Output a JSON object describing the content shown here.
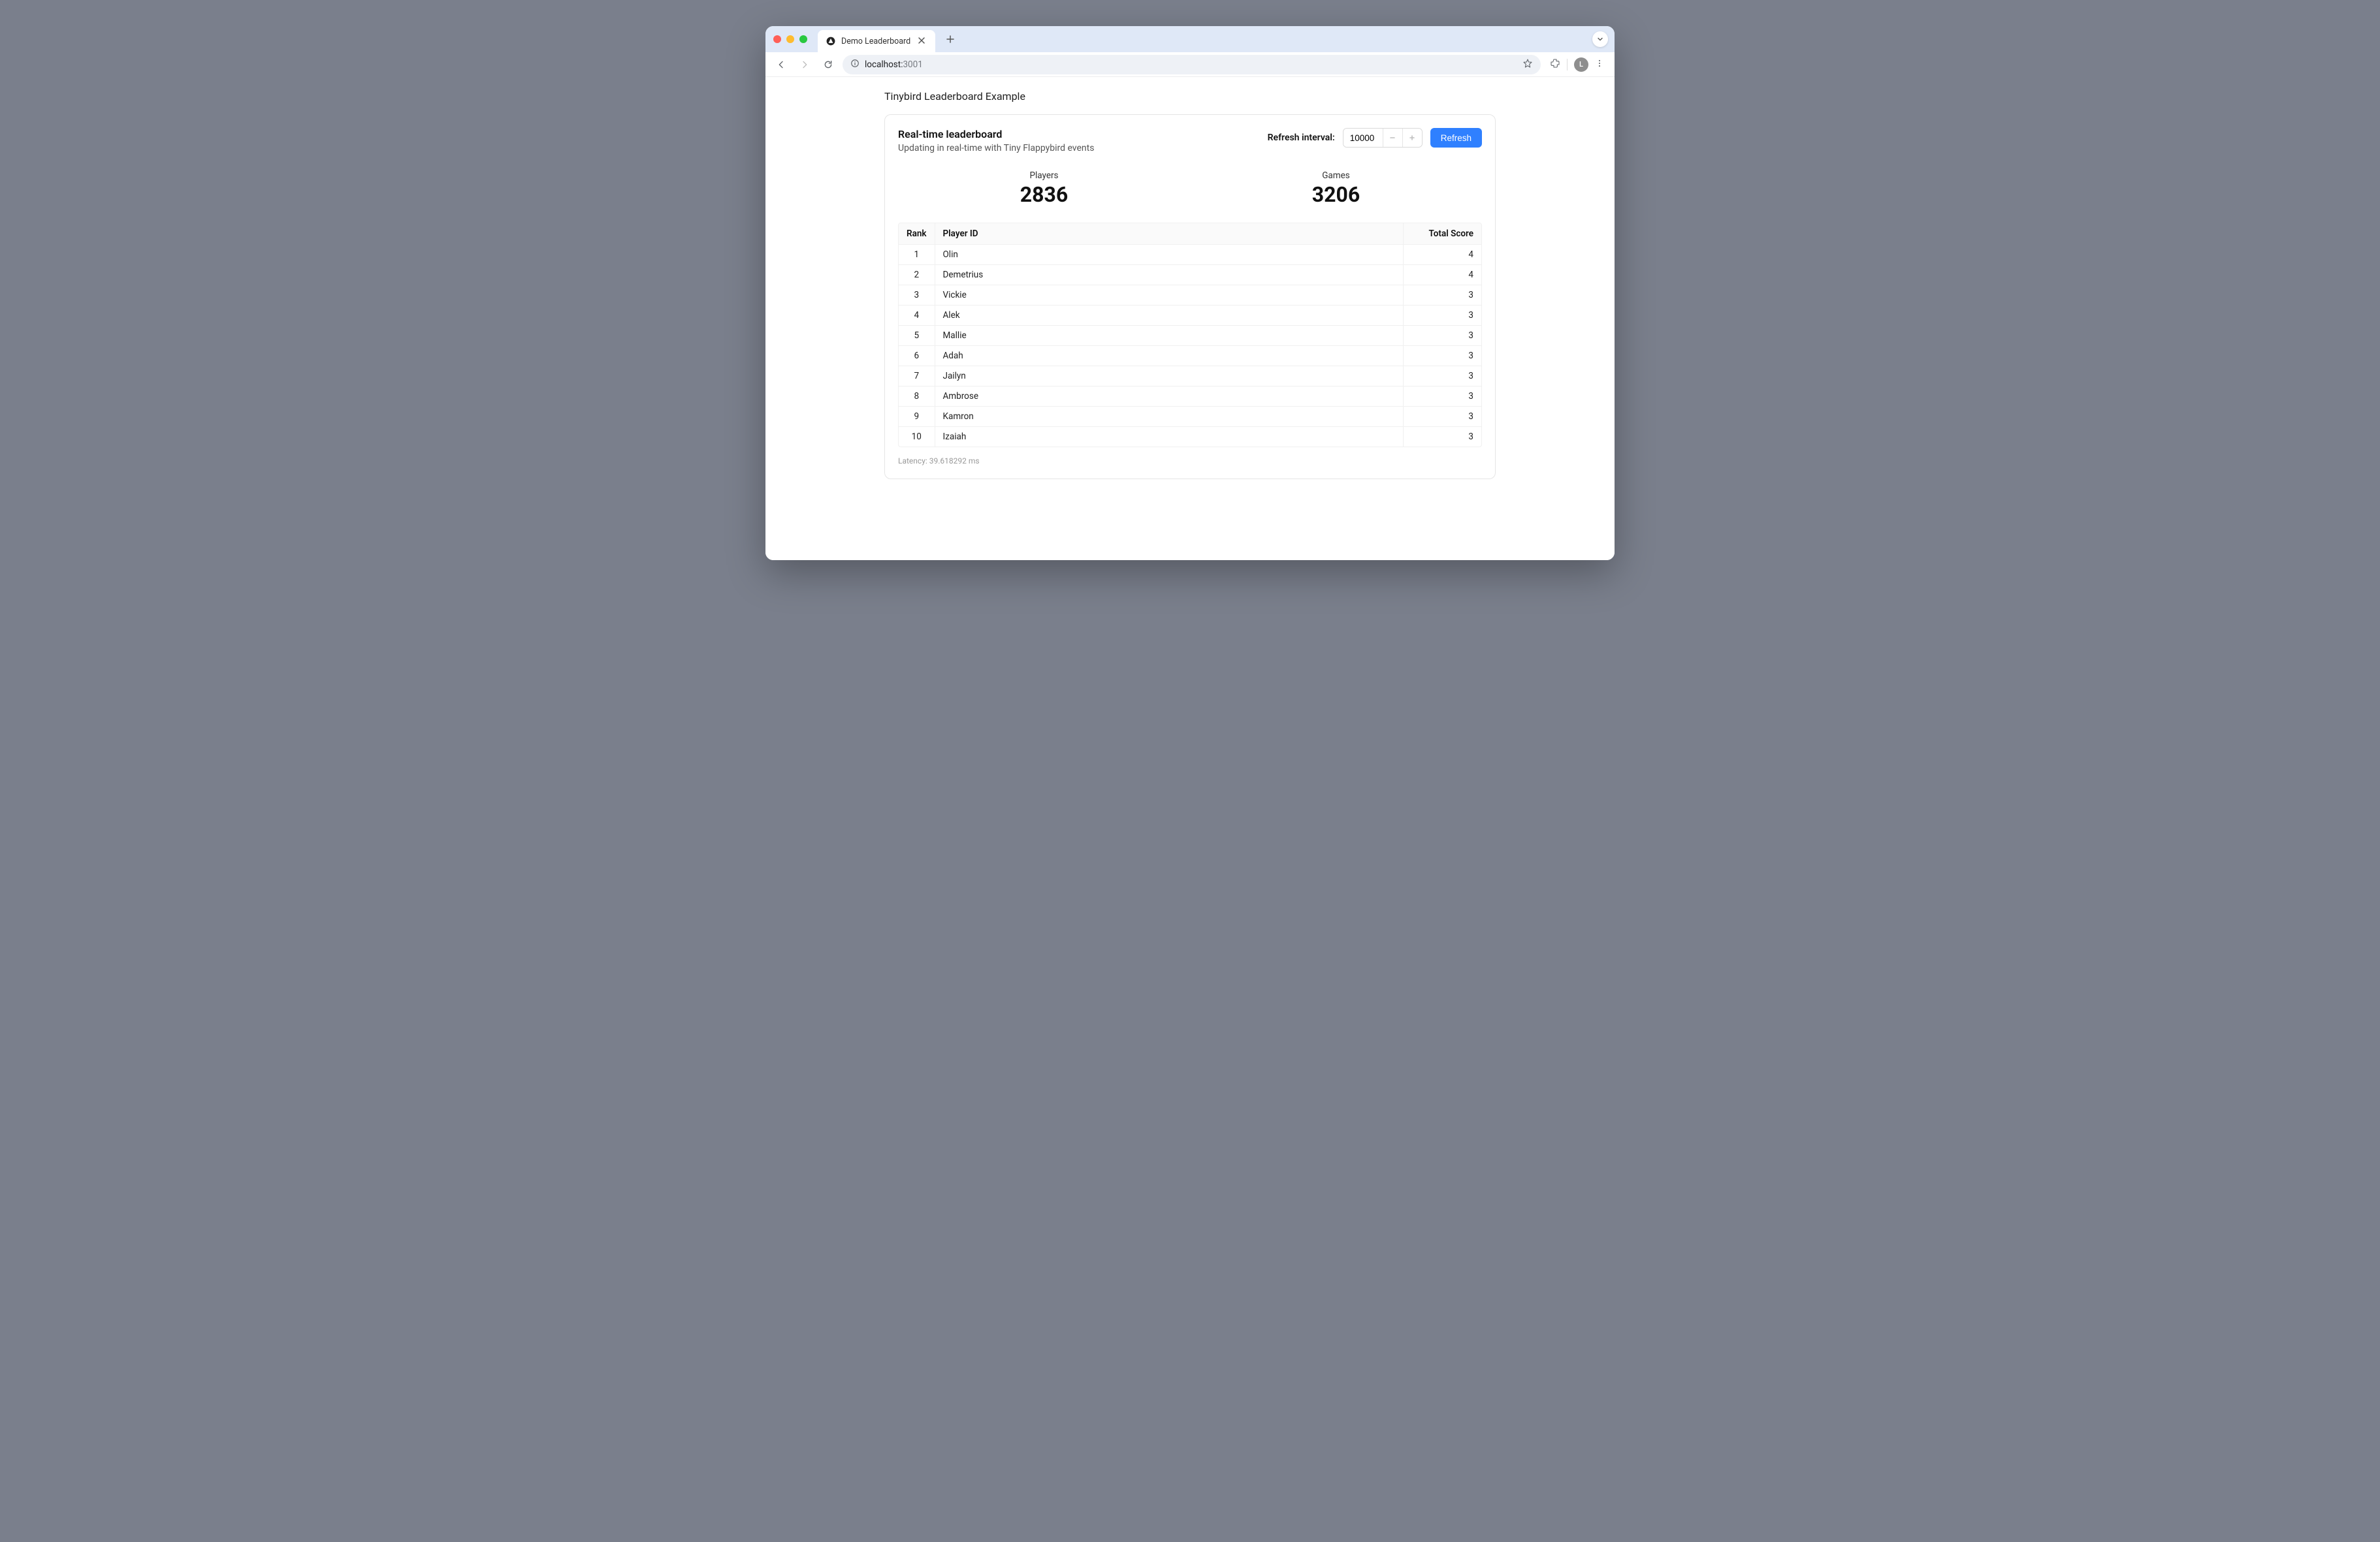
{
  "browser": {
    "tab_title": "Demo Leaderboard",
    "url_host": "localhost:",
    "url_port": "3001",
    "profile_initial": "L"
  },
  "page": {
    "title": "Tinybird Leaderboard Example",
    "card_heading": "Real-time leaderboard",
    "card_sub": "Updating in real-time with Tiny Flappybird events",
    "refresh_label": "Refresh interval:",
    "refresh_value": "10000",
    "refresh_button": "Refresh",
    "stats": {
      "players_label": "Players",
      "players_value": "2836",
      "games_label": "Games",
      "games_value": "3206"
    },
    "table": {
      "col_rank": "Rank",
      "col_player": "Player ID",
      "col_score": "Total Score",
      "rows": [
        {
          "rank": "1",
          "player": "Olin",
          "score": "4"
        },
        {
          "rank": "2",
          "player": "Demetrius",
          "score": "4"
        },
        {
          "rank": "3",
          "player": "Vickie",
          "score": "3"
        },
        {
          "rank": "4",
          "player": "Alek",
          "score": "3"
        },
        {
          "rank": "5",
          "player": "Mallie",
          "score": "3"
        },
        {
          "rank": "6",
          "player": "Adah",
          "score": "3"
        },
        {
          "rank": "7",
          "player": "Jailyn",
          "score": "3"
        },
        {
          "rank": "8",
          "player": "Ambrose",
          "score": "3"
        },
        {
          "rank": "9",
          "player": "Kamron",
          "score": "3"
        },
        {
          "rank": "10",
          "player": "Izaiah",
          "score": "3"
        }
      ]
    },
    "latency": "Latency: 39.618292 ms"
  }
}
